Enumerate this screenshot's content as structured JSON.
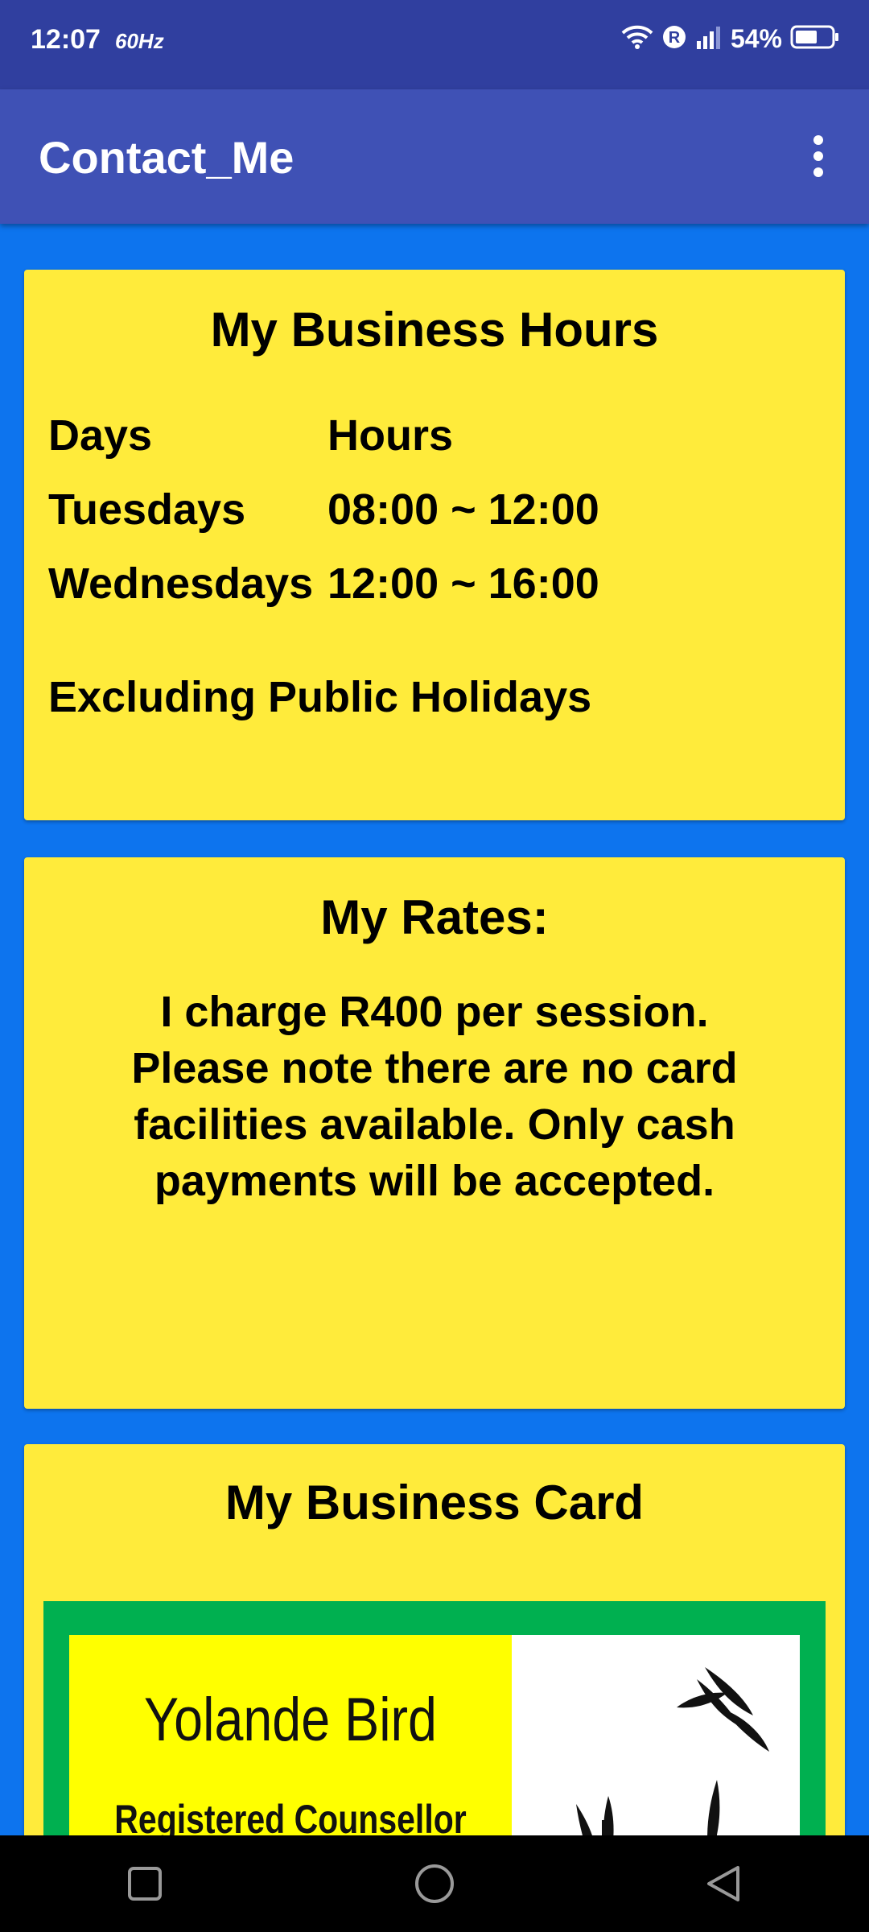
{
  "status_bar": {
    "time": "12:07",
    "refresh_rate": "60Hz",
    "battery": "54%"
  },
  "app_bar": {
    "title": "Contact_Me"
  },
  "business_hours": {
    "title": "My Business Hours",
    "header": {
      "day": "Days",
      "hours": "Hours"
    },
    "rows": [
      {
        "day": "Tuesdays",
        "hours": "08:00 ~ 12:00"
      },
      {
        "day": "Wednesdays",
        "hours": "12:00 ~ 16:00"
      }
    ],
    "note": "Excluding Public Holidays"
  },
  "rates": {
    "title": "My Rates:",
    "text": "I charge R400 per session. Please note there are no card facilities available. Only cash payments will be accepted."
  },
  "business_card": {
    "title": "My Business Card",
    "name": "Yolande Bird",
    "role": "Registered Counsellor"
  },
  "colors": {
    "background": "#0d74ee",
    "card": "#ffeb3b",
    "app_bar": "#3f51b5",
    "status_bar": "#303f9f"
  }
}
